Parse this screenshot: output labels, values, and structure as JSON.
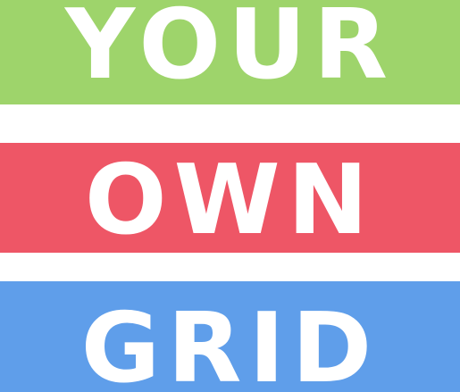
{
  "bands": [
    {
      "text": "YOUR",
      "color": "#9ed46b"
    },
    {
      "text": "OWN",
      "color": "#ee5666"
    },
    {
      "text": "GRID",
      "color": "#5f9eea"
    }
  ],
  "background": "#ffffff"
}
